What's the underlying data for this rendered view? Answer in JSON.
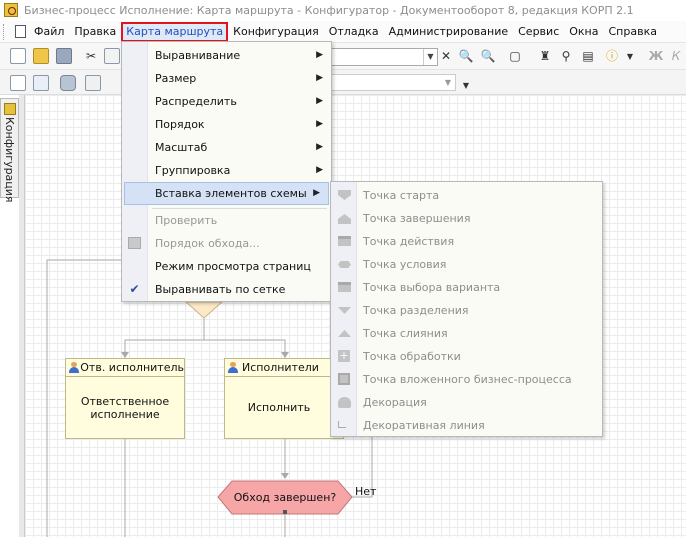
{
  "window": {
    "title": "Бизнес-процесс Исполнение: Карта маршрута - Конфигуратор - Документооборот 8, редакция КОРП 2.1"
  },
  "menubar": {
    "items": [
      "Файл",
      "Правка",
      "Карта маршрута",
      "Конфигурация",
      "Отладка",
      "Администрирование",
      "Сервис",
      "Окна",
      "Справка"
    ],
    "active": "Карта маршрута"
  },
  "sidetab": {
    "label": "Конфигурация"
  },
  "route_menu": {
    "items": [
      {
        "label": "Выравнивание",
        "submenu": true
      },
      {
        "label": "Размер",
        "submenu": true
      },
      {
        "label": "Распределить",
        "submenu": true
      },
      {
        "label": "Порядок",
        "submenu": true
      },
      {
        "label": "Масштаб",
        "submenu": true
      },
      {
        "label": "Группировка",
        "submenu": true
      },
      {
        "label": "Вставка элементов схемы",
        "submenu": true,
        "highlighted": true
      },
      {
        "label": "Проверить",
        "disabled": true
      },
      {
        "label": "Порядок обхода...",
        "disabled": true
      },
      {
        "label": "Режим просмотра страниц"
      },
      {
        "label": "Выравнивать по сетке",
        "checked": true
      }
    ]
  },
  "insert_submenu": {
    "items": [
      "Точка старта",
      "Точка завершения",
      "Точка действия",
      "Точка условия",
      "Точка выбора варианта",
      "Точка разделения",
      "Точка слияния",
      "Точка обработки",
      "Точка вложенного бизнес-процесса",
      "Декорация",
      "Декоративная линия"
    ]
  },
  "diagram": {
    "task1": {
      "header": "Отв. исполнитель",
      "body": [
        "Ответственное",
        "исполнение"
      ]
    },
    "task2": {
      "header": "Исполнители",
      "body": [
        "Исполнить"
      ]
    },
    "condition": {
      "label": "Обход завершен?",
      "no_label": "Нет"
    }
  },
  "colors": {
    "accent_red": "#e0141c",
    "highlight": "#d5e2f5",
    "task_fill": "#fffddd",
    "condition_fill": "#f6a6a6"
  }
}
